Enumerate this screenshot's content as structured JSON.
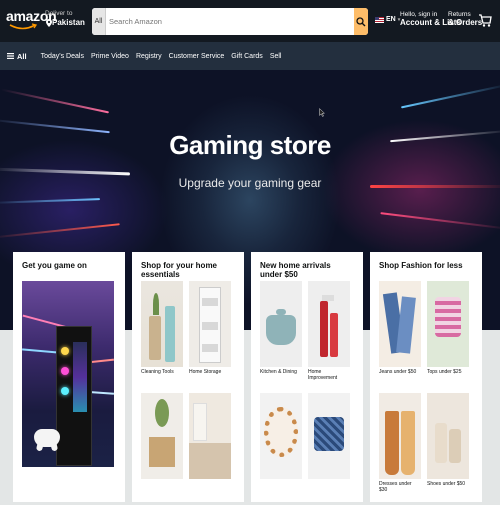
{
  "header": {
    "logo": "amazon",
    "deliver_to": "Deliver to",
    "location": "Pakistan",
    "search": {
      "category": "All",
      "placeholder": "Search Amazon"
    },
    "language": "EN",
    "account_top": "Hello, sign in",
    "account_bottom": "Account & Lists",
    "returns_top": "Returns",
    "returns_bottom": "& Orders"
  },
  "subnav": {
    "all_label": "All",
    "items": [
      "Today's Deals",
      "Prime Video",
      "Registry",
      "Customer Service",
      "Gift Cards",
      "Sell"
    ]
  },
  "hero": {
    "title": "Gaming store",
    "subtitle": "Upgrade your gaming gear"
  },
  "cards": [
    {
      "title": "Get you game on",
      "tiles": []
    },
    {
      "title": "Shop for your home essentials",
      "tiles": [
        {
          "caption": "Cleaning Tools"
        },
        {
          "caption": "Home Storage"
        },
        {
          "caption": ""
        },
        {
          "caption": ""
        }
      ]
    },
    {
      "title": "New home arrivals under $50",
      "tiles": [
        {
          "caption": "Kitchen & Dining"
        },
        {
          "caption": "Home Improvement"
        },
        {
          "caption": ""
        },
        {
          "caption": ""
        }
      ]
    },
    {
      "title": "Shop Fashion for less",
      "tiles": [
        {
          "caption": "Jeans under $50"
        },
        {
          "caption": "Tops under $25"
        },
        {
          "caption": "Dresses under $30"
        },
        {
          "caption": "Shoes under $50"
        }
      ]
    }
  ],
  "colors": {
    "nav_dark": "#131921",
    "subnav": "#232f3e",
    "search_button": "#febd69",
    "page_bg": "#e3e6e6"
  },
  "icons": [
    "location-pin-icon",
    "search-icon",
    "us-flag-icon",
    "cart-icon",
    "hamburger-icon"
  ]
}
